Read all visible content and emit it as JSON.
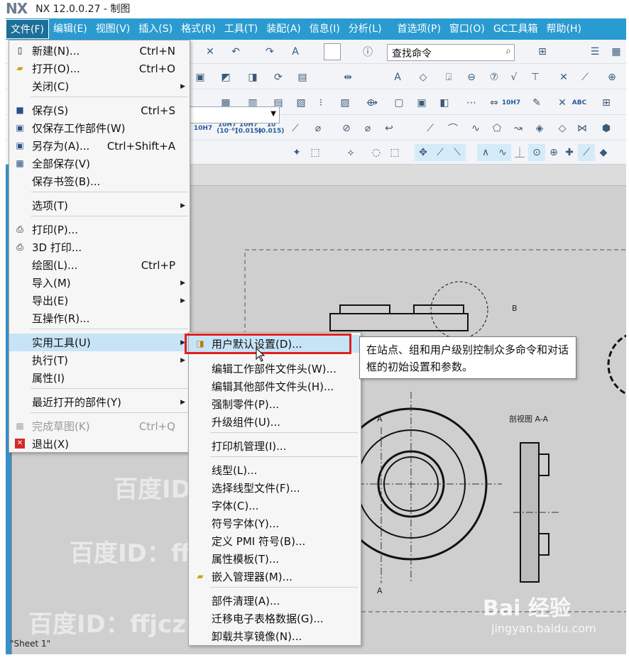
{
  "window": {
    "logo": "NX",
    "title": "NX 12.0.0.27 - 制图"
  },
  "menubar": {
    "items": [
      "文件(F)",
      "编辑(E)",
      "视图(V)",
      "插入(S)",
      "格式(R)",
      "工具(T)",
      "装配(A)",
      "信息(I)",
      "分析(L)",
      "首选项(P)",
      "窗口(O)",
      "GC工具箱",
      "帮助(H)"
    ]
  },
  "toolbar": {
    "search_value": "查找命令",
    "tolerance_labels": [
      "10H7",
      "10H7 (10⁻⁰)",
      "10H7 (0.015)",
      "10 (0.015)",
      "10H7",
      "ABC"
    ]
  },
  "file_menu": {
    "items": [
      {
        "label": "新建(N)...",
        "shortcut": "Ctrl+N",
        "icon": "new-file-icon"
      },
      {
        "label": "打开(O)...",
        "shortcut": "Ctrl+O",
        "icon": "open-folder-icon"
      },
      {
        "label": "关闭(C)",
        "shortcut": "",
        "icon": "",
        "submenu": true
      },
      {
        "label": "保存(S)",
        "shortcut": "Ctrl+S",
        "icon": "save-icon"
      },
      {
        "label": "仅保存工作部件(W)",
        "shortcut": "",
        "icon": "save-work-part-icon"
      },
      {
        "label": "另存为(A)...",
        "shortcut": "Ctrl+Shift+A",
        "icon": "save-as-icon"
      },
      {
        "label": "全部保存(V)",
        "shortcut": "",
        "icon": "save-all-icon"
      },
      {
        "label": "保存书签(B)...",
        "shortcut": "",
        "icon": ""
      },
      {
        "label": "选项(T)",
        "shortcut": "",
        "icon": "",
        "submenu": true
      },
      {
        "label": "打印(P)...",
        "shortcut": "",
        "icon": "print-icon"
      },
      {
        "label": "3D 打印...",
        "shortcut": "",
        "icon": "print-3d-icon"
      },
      {
        "label": "绘图(L)...",
        "shortcut": "Ctrl+P",
        "icon": ""
      },
      {
        "label": "导入(M)",
        "shortcut": "",
        "icon": "",
        "submenu": true
      },
      {
        "label": "导出(E)",
        "shortcut": "",
        "icon": "",
        "submenu": true
      },
      {
        "label": "互操作(R)...",
        "shortcut": "",
        "icon": ""
      },
      {
        "label": "实用工具(U)",
        "shortcut": "",
        "icon": "",
        "submenu": true,
        "highlighted": true
      },
      {
        "label": "执行(T)",
        "shortcut": "",
        "icon": "",
        "submenu": true
      },
      {
        "label": "属性(I)",
        "shortcut": "",
        "icon": ""
      },
      {
        "label": "最近打开的部件(Y)",
        "shortcut": "",
        "icon": "",
        "submenu": true
      },
      {
        "label": "完成草图(K)",
        "shortcut": "Ctrl+Q",
        "icon": "finish-sketch-icon",
        "disabled": true
      },
      {
        "label": "退出(X)",
        "shortcut": "",
        "icon": "exit-icon"
      }
    ]
  },
  "utilities_submenu": {
    "items": [
      {
        "label": "用户默认设置(D)...",
        "icon": "user-defaults-icon"
      },
      {
        "label": "编辑工作部件文件头(W)..."
      },
      {
        "label": "编辑其他部件文件头(H)..."
      },
      {
        "label": "强制零件(P)..."
      },
      {
        "label": "升级组件(U)..."
      },
      {
        "label": "打印机管理(I)..."
      },
      {
        "label": "线型(L)..."
      },
      {
        "label": "选择线型文件(F)..."
      },
      {
        "label": "字体(C)..."
      },
      {
        "label": "符号字体(Y)..."
      },
      {
        "label": "定义 PMI 符号(B)..."
      },
      {
        "label": "属性模板(T)..."
      },
      {
        "label": "嵌入管理器(M)...",
        "icon": "embed-manager-icon"
      },
      {
        "label": "部件清理(A)..."
      },
      {
        "label": "迁移电子表格数据(G)..."
      },
      {
        "label": "卸载共享镜像(N)..."
      }
    ]
  },
  "tooltip": {
    "text": "在站点、组和用户级别控制众多命令和对话框的初始设置和参数。"
  },
  "drawing": {
    "sheet_name": "\"Sheet 1\"",
    "label_b": "B",
    "label_a1": "A",
    "label_a2": "A",
    "section_label": "剖视图 A-A"
  },
  "watermarks": {
    "id_text_1": "百度ID：ffjczr",
    "id_text_2": "百度ID：ffjczr",
    "id_text_3": "百度ID：ffjczr",
    "baidu_logo": "Bai 经验",
    "baidu_url": "jingyan.baidu.com"
  },
  "colors": {
    "menubar": "#2a9bd1",
    "highlight": "#c7e4f7",
    "redbox": "#e0201c"
  }
}
